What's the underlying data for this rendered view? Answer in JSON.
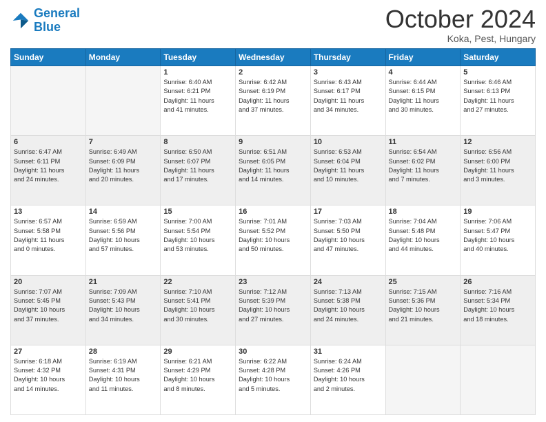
{
  "header": {
    "logo_line1": "General",
    "logo_line2": "Blue",
    "month": "October 2024",
    "location": "Koka, Pest, Hungary"
  },
  "weekdays": [
    "Sunday",
    "Monday",
    "Tuesday",
    "Wednesday",
    "Thursday",
    "Friday",
    "Saturday"
  ],
  "rows": [
    [
      {
        "day": "",
        "info": ""
      },
      {
        "day": "",
        "info": ""
      },
      {
        "day": "1",
        "info": "Sunrise: 6:40 AM\nSunset: 6:21 PM\nDaylight: 11 hours\nand 41 minutes."
      },
      {
        "day": "2",
        "info": "Sunrise: 6:42 AM\nSunset: 6:19 PM\nDaylight: 11 hours\nand 37 minutes."
      },
      {
        "day": "3",
        "info": "Sunrise: 6:43 AM\nSunset: 6:17 PM\nDaylight: 11 hours\nand 34 minutes."
      },
      {
        "day": "4",
        "info": "Sunrise: 6:44 AM\nSunset: 6:15 PM\nDaylight: 11 hours\nand 30 minutes."
      },
      {
        "day": "5",
        "info": "Sunrise: 6:46 AM\nSunset: 6:13 PM\nDaylight: 11 hours\nand 27 minutes."
      }
    ],
    [
      {
        "day": "6",
        "info": "Sunrise: 6:47 AM\nSunset: 6:11 PM\nDaylight: 11 hours\nand 24 minutes."
      },
      {
        "day": "7",
        "info": "Sunrise: 6:49 AM\nSunset: 6:09 PM\nDaylight: 11 hours\nand 20 minutes."
      },
      {
        "day": "8",
        "info": "Sunrise: 6:50 AM\nSunset: 6:07 PM\nDaylight: 11 hours\nand 17 minutes."
      },
      {
        "day": "9",
        "info": "Sunrise: 6:51 AM\nSunset: 6:05 PM\nDaylight: 11 hours\nand 14 minutes."
      },
      {
        "day": "10",
        "info": "Sunrise: 6:53 AM\nSunset: 6:04 PM\nDaylight: 11 hours\nand 10 minutes."
      },
      {
        "day": "11",
        "info": "Sunrise: 6:54 AM\nSunset: 6:02 PM\nDaylight: 11 hours\nand 7 minutes."
      },
      {
        "day": "12",
        "info": "Sunrise: 6:56 AM\nSunset: 6:00 PM\nDaylight: 11 hours\nand 3 minutes."
      }
    ],
    [
      {
        "day": "13",
        "info": "Sunrise: 6:57 AM\nSunset: 5:58 PM\nDaylight: 11 hours\nand 0 minutes."
      },
      {
        "day": "14",
        "info": "Sunrise: 6:59 AM\nSunset: 5:56 PM\nDaylight: 10 hours\nand 57 minutes."
      },
      {
        "day": "15",
        "info": "Sunrise: 7:00 AM\nSunset: 5:54 PM\nDaylight: 10 hours\nand 53 minutes."
      },
      {
        "day": "16",
        "info": "Sunrise: 7:01 AM\nSunset: 5:52 PM\nDaylight: 10 hours\nand 50 minutes."
      },
      {
        "day": "17",
        "info": "Sunrise: 7:03 AM\nSunset: 5:50 PM\nDaylight: 10 hours\nand 47 minutes."
      },
      {
        "day": "18",
        "info": "Sunrise: 7:04 AM\nSunset: 5:48 PM\nDaylight: 10 hours\nand 44 minutes."
      },
      {
        "day": "19",
        "info": "Sunrise: 7:06 AM\nSunset: 5:47 PM\nDaylight: 10 hours\nand 40 minutes."
      }
    ],
    [
      {
        "day": "20",
        "info": "Sunrise: 7:07 AM\nSunset: 5:45 PM\nDaylight: 10 hours\nand 37 minutes."
      },
      {
        "day": "21",
        "info": "Sunrise: 7:09 AM\nSunset: 5:43 PM\nDaylight: 10 hours\nand 34 minutes."
      },
      {
        "day": "22",
        "info": "Sunrise: 7:10 AM\nSunset: 5:41 PM\nDaylight: 10 hours\nand 30 minutes."
      },
      {
        "day": "23",
        "info": "Sunrise: 7:12 AM\nSunset: 5:39 PM\nDaylight: 10 hours\nand 27 minutes."
      },
      {
        "day": "24",
        "info": "Sunrise: 7:13 AM\nSunset: 5:38 PM\nDaylight: 10 hours\nand 24 minutes."
      },
      {
        "day": "25",
        "info": "Sunrise: 7:15 AM\nSunset: 5:36 PM\nDaylight: 10 hours\nand 21 minutes."
      },
      {
        "day": "26",
        "info": "Sunrise: 7:16 AM\nSunset: 5:34 PM\nDaylight: 10 hours\nand 18 minutes."
      }
    ],
    [
      {
        "day": "27",
        "info": "Sunrise: 6:18 AM\nSunset: 4:32 PM\nDaylight: 10 hours\nand 14 minutes."
      },
      {
        "day": "28",
        "info": "Sunrise: 6:19 AM\nSunset: 4:31 PM\nDaylight: 10 hours\nand 11 minutes."
      },
      {
        "day": "29",
        "info": "Sunrise: 6:21 AM\nSunset: 4:29 PM\nDaylight: 10 hours\nand 8 minutes."
      },
      {
        "day": "30",
        "info": "Sunrise: 6:22 AM\nSunset: 4:28 PM\nDaylight: 10 hours\nand 5 minutes."
      },
      {
        "day": "31",
        "info": "Sunrise: 6:24 AM\nSunset: 4:26 PM\nDaylight: 10 hours\nand 2 minutes."
      },
      {
        "day": "",
        "info": ""
      },
      {
        "day": "",
        "info": ""
      }
    ]
  ]
}
